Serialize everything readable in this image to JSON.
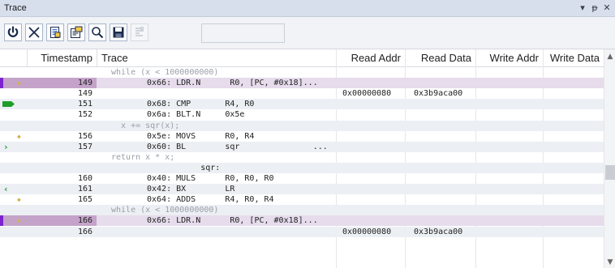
{
  "window": {
    "title": "Trace",
    "controls": {
      "menu": "▾",
      "pin": "ᵽ",
      "close": "✕"
    }
  },
  "toolbar": {
    "buttons": [
      {
        "name": "power-button",
        "icon": "power-icon"
      },
      {
        "name": "clear-button",
        "icon": "close-x-icon"
      },
      {
        "name": "copy-button",
        "icon": "copy-icon"
      },
      {
        "name": "export-button",
        "icon": "export-icon"
      },
      {
        "name": "find-button",
        "icon": "search-icon"
      },
      {
        "name": "save-button",
        "icon": "save-icon"
      },
      {
        "name": "settings-button",
        "icon": "settings-icon",
        "disabled": true
      }
    ]
  },
  "columns": [
    "Timestamp",
    "Trace",
    "Read Addr",
    "Read Data",
    "Write Addr",
    "Write Data"
  ],
  "rows": [
    {
      "ts": "",
      "trace": "while (x < 1000000000)",
      "src": true
    },
    {
      "ts": "149",
      "trace": "0x66: LDR.N      R0, [PC, #0x18]...",
      "icon": "diamond",
      "highlight": true
    },
    {
      "ts": "149",
      "trace": "",
      "raddr": "0x00000080",
      "rdata": "0x3b9aca00"
    },
    {
      "ts": "151",
      "trace": "0x68: CMP       R4, R0",
      "icon": "green-flag"
    },
    {
      "ts": "152",
      "trace": "0x6a: BLT.N     0x5e"
    },
    {
      "ts": "",
      "trace": "  x += sqr(x);",
      "src": true
    },
    {
      "ts": "156",
      "trace": "0x5e: MOVS      R0, R4",
      "icon": "diamond"
    },
    {
      "ts": "157",
      "trace": "0x60: BL        sqr               ...",
      "icon": "call"
    },
    {
      "ts": "",
      "trace": "return x * x;",
      "src": true
    },
    {
      "ts": "",
      "trace": "           sqr:",
      "label": true
    },
    {
      "ts": "160",
      "trace": "0x40: MULS      R0, R0, R0"
    },
    {
      "ts": "161",
      "trace": "0x42: BX        LR",
      "icon": "return"
    },
    {
      "ts": "165",
      "trace": "0x64: ADDS      R4, R0, R4",
      "icon": "diamond"
    },
    {
      "ts": "",
      "trace": "while (x < 1000000000)",
      "src": true
    },
    {
      "ts": "166",
      "trace": "0x66: LDR.N      R0, [PC, #0x18]...",
      "icon": "diamond",
      "highlight": true
    },
    {
      "ts": "166",
      "trace": "",
      "raddr": "0x00000080",
      "rdata": "0x3b9aca00"
    }
  ],
  "colors": {
    "marker": "#7e22ce",
    "diamond": "#d4b24c",
    "green": "#1f9d2a",
    "highlight": "#c4a3c9"
  }
}
